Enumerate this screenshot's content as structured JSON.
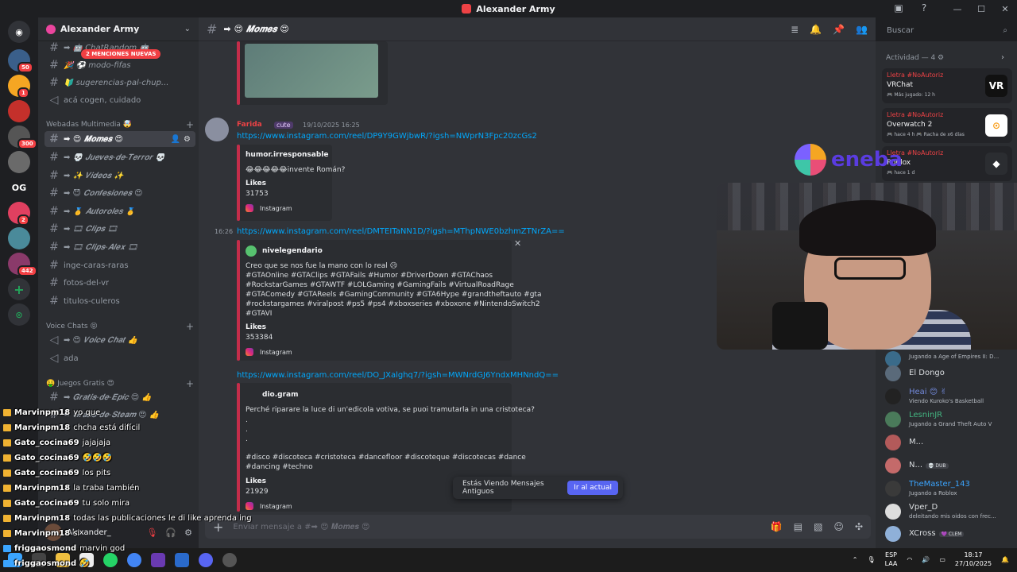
{
  "window": {
    "title": "Alexander Army",
    "controls": [
      "—",
      "☐",
      "✕"
    ]
  },
  "servers": {
    "badges": [
      "50",
      "1",
      "300",
      "2",
      "442"
    ],
    "og_label": "OG"
  },
  "guild": {
    "name": "Alexander Army",
    "mentions_pill": "2 MENCIONES NUEVAS",
    "channels_top": [
      {
        "label": "➡ 🤖 ChatRandom 🤖"
      },
      {
        "label": "🎉 ⚽ modo-fifas"
      },
      {
        "label": "🔰 sugerencias-pal-chup..."
      },
      {
        "label": "acá cogen, cuidado"
      }
    ],
    "cat_multimedia": "Webadas Multimedia 🤯",
    "channels_multimedia": [
      {
        "label": "➡ 😍 𝑴𝒐𝒎𝒆𝒔 😍"
      },
      {
        "label": "➡ 💀 𝑱𝒖𝒆𝒗𝒆𝒔-𝒅𝒆-𝑻𝒆𝒓𝒓𝒐𝒓 💀"
      },
      {
        "label": "➡ ✨ 𝑽𝒊𝒅𝒆𝒐𝒔 ✨"
      },
      {
        "label": "➡ 😈 𝑪𝒐𝒏𝒇𝒆𝒔𝒊𝒐𝒏𝒆𝒔 😍"
      },
      {
        "label": "➡ 🥇 𝑨𝒖𝒕𝒐𝒓𝒐𝒍𝒆𝒔 🥇"
      },
      {
        "label": "➡ 🎞 𝑪𝒍𝒊𝒑𝒔 🎞"
      },
      {
        "label": "➡ 🎞 𝑪𝒍𝒊𝒑𝒔-𝑨𝒍𝒆𝒙 🎞"
      },
      {
        "label": "inge-caras-raras"
      },
      {
        "label": "fotos-del-vr"
      },
      {
        "label": "titulos-culeros"
      }
    ],
    "cat_voice": "Voice Chats 😝",
    "channels_voice": [
      {
        "label": "➡ 😍 𝑽𝒐𝒊𝒄𝒆 𝑪𝒉𝒂𝒕 👍"
      },
      {
        "label": "ada"
      }
    ],
    "cat_games": "🤑 Juegos Gratis 😍",
    "channels_games": [
      {
        "label": "➡ 𝑮𝒓𝒂𝒕𝒊𝒔-𝒅𝒆-𝑬𝒑𝒊𝒄 😍 👍"
      },
      {
        "label": "➡ 𝑮𝒓𝒂𝒕𝒊𝒔-𝒅𝒆-𝑺𝒕𝒆𝒂𝒎 😍 👍"
      }
    ]
  },
  "stream_chat": [
    {
      "user": "Marvinpm18",
      "text": "yo que"
    },
    {
      "user": "Marvinpm18",
      "text": "chcha está difícil"
    },
    {
      "user": "Gato_cocina69",
      "text": "jajajaja"
    },
    {
      "user": "Gato_cocina69",
      "text": "🤣🤣🤣"
    },
    {
      "user": "Gato_cocina69",
      "text": "los pits"
    },
    {
      "user": "Marvinpm18",
      "text": "la traba también"
    },
    {
      "user": "Gato_cocina69",
      "text": "tu solo mira"
    },
    {
      "user": "Marvinpm18",
      "text": "todas las publicaciones le di like aprenda ing"
    },
    {
      "user": "Marvinpm18",
      "text": "si"
    },
    {
      "user": "friggaosmond",
      "text": "marvin god"
    },
    {
      "user": "friggaosmond",
      "text": "🤣"
    }
  ],
  "user_panel": {
    "name": "Alexander_"
  },
  "channel_header": {
    "name": "➡ 😍 𝑴𝒐𝒎𝒆𝒔 😍",
    "search_placeholder": "Buscar"
  },
  "messages": {
    "author": "Farida",
    "author_tag": "cute",
    "timestamp": "19/10/2025 16:25",
    "link1": "https://www.instagram.com/reel/DP9Y9GWjbwR/?igsh=NWprN3Fpc20zcGs2",
    "embed1": {
      "author": "humor.irresponsable",
      "text": "😂😂😂😂😂invente Román?",
      "likes_label": "Likes",
      "likes": "31753",
      "source": "Instagram"
    },
    "time2": "16:26",
    "link2": "https://www.instagram.com/reel/DMTEITaNN1D/?igsh=MThpNWE0bzhmZTNrZA==",
    "embed2": {
      "author": "nivelegendario",
      "lines": [
        "Creo que se nos fue la mano con lo real 😥",
        "#GTAOnline #GTAClips #GTAFails #Humor #DriverDown #GTAChaos",
        "#RockstarGames #GTAWTF #LOLGaming #GamingFails #VirtualRoadRage",
        "#GTAComedy #GTAReels #GamingCommunity #GTA6Hype #grandtheftauto #gta",
        "#rockstargames #viralpost #ps5 #ps4 #xboxseries #xboxone #NintendoSwitch2",
        "#GTAVI"
      ],
      "likes_label": "Likes",
      "likes": "353384",
      "source": "Instagram"
    },
    "link3": "https://www.instagram.com/reel/DO_JXalghq7/?igsh=MWNrdGJ6YndxMHNndQ==",
    "embed3": {
      "author": "dio.gram",
      "lines": [
        "Perché riparare la luce di un'edicola votiva, se puoi tramutarla in una cristoteca?",
        ".",
        ".",
        ".",
        "#disco #discoteca #cristoteca #dancefloor #discoteque #discotecas #dance",
        "#dancing #techno"
      ],
      "likes_label": "Likes",
      "likes": "21929",
      "source": "Instagram"
    },
    "old_notice": "Estás Viendo Mensajes Antiguos",
    "old_button": "Ir al actual"
  },
  "composer": {
    "placeholder": "Enviar mensaje a #➡ 😍 𝑴𝒐𝒎𝒆𝒔 😍"
  },
  "activity": {
    "header": "Actividad — 4 ⚙",
    "cards": [
      {
        "user": "Lletra #NoAutoriz",
        "game": "VRChat",
        "sub": "🎮 Más jugado: 12 h",
        "thumb": "VR",
        "color": "#f2f3f5"
      },
      {
        "user": "Lletra #NoAutoriz",
        "game": "Overwatch 2",
        "sub": "🎮 hace 4 h   🎮 Racha de x6 días",
        "thumb": "⊙",
        "color": "#f99e1a"
      },
      {
        "user": "Lletra #NoAutoriz",
        "game": "Roblox",
        "sub": "🎮 hace 1 d",
        "thumb": "◆",
        "color": "#e2e2e2"
      }
    ]
  },
  "members": [
    {
      "name": "",
      "sub": "Jugando a Age of Empires II: D...",
      "color": "#3a6b8a"
    },
    {
      "name": "El Dongo",
      "sub": "",
      "color": "#5a6a7a"
    },
    {
      "name": "Heai 😊 ✌",
      "sub": "Viendo Kuroko's Basketball",
      "color": "#222",
      "name_color": "#7289da"
    },
    {
      "name": "LesninJR",
      "sub": "Jugando a Grand Theft Auto V",
      "color": "#4a7a5a",
      "name_color": "#43b581"
    },
    {
      "name": "M...",
      "sub": "",
      "color": "#b35a5a"
    },
    {
      "name": "N...",
      "badge": "💀 DUB",
      "sub": "",
      "color": "#c46a6a"
    },
    {
      "name": "TheMaster_143",
      "sub": "Jugando a Roblox",
      "color": "#3a3a3a",
      "name_color": "#3ba5ff"
    },
    {
      "name": "Vper_D",
      "sub": "deleitando mis oidos con frec...",
      "color": "#dddddd"
    },
    {
      "name": "XCross",
      "badge": "💜 CLEM",
      "sub": "",
      "color": "#8fb0d8"
    }
  ],
  "overlay": {
    "brand": "eneba"
  },
  "taskbar": {
    "lang": "ESP",
    "lang2": "LAA",
    "time": "18:17",
    "date": "27/10/2025"
  },
  "colors": {
    "accent": "#5865f2",
    "link": "#00a8fc",
    "danger": "#f23f43",
    "embed_bar": "#c42d4a"
  }
}
